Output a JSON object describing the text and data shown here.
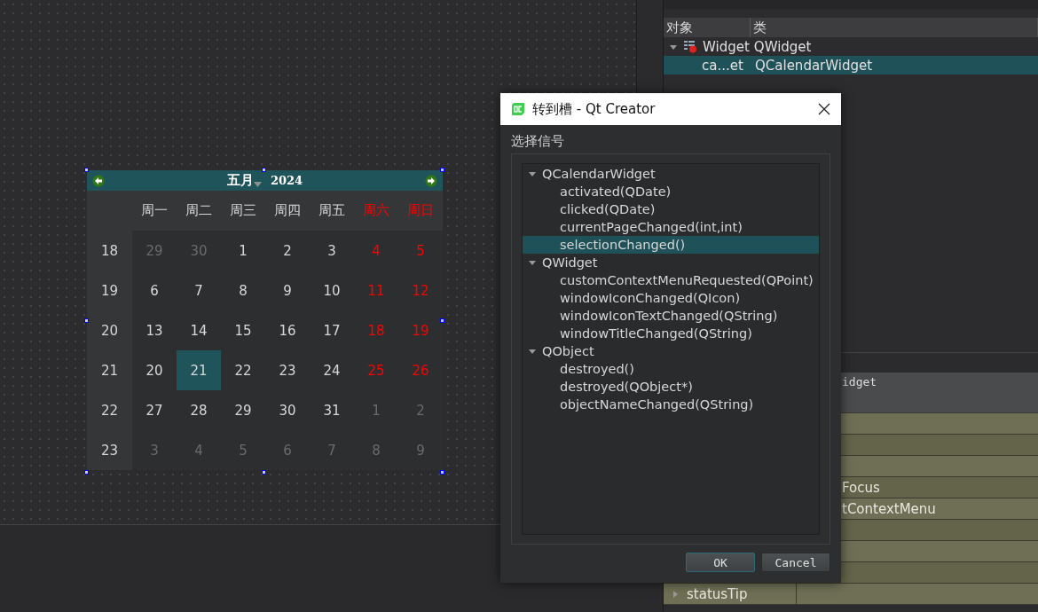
{
  "object_inspector": {
    "columns": [
      "对象",
      "类"
    ],
    "rows": [
      {
        "object": "Widget",
        "class": "QWidget",
        "expanded": true,
        "selected": false,
        "children": [
          {
            "object": "ca...et",
            "class": "QCalendarWidget",
            "selected": true
          }
        ]
      }
    ]
  },
  "property_editor": {
    "header": "idget",
    "rows": [
      {
        "kind": "group"
      },
      {
        "kind": "property"
      },
      {
        "kind": "property"
      },
      {
        "kind": "property"
      },
      {
        "kind": "property",
        "value": "Focus"
      },
      {
        "kind": "property",
        "value": "tContextMenu"
      },
      {
        "kind": "property"
      },
      {
        "kind": "property"
      },
      {
        "kind": "property"
      },
      {
        "kind": "expandable",
        "name": "statusTip"
      }
    ]
  },
  "calendar": {
    "month": "五月",
    "year": "2024",
    "weekdays": [
      {
        "label": "周一",
        "weekend": false
      },
      {
        "label": "周二",
        "weekend": false
      },
      {
        "label": "周三",
        "weekend": false
      },
      {
        "label": "周四",
        "weekend": false
      },
      {
        "label": "周五",
        "weekend": false
      },
      {
        "label": "周六",
        "weekend": true
      },
      {
        "label": "周日",
        "weekend": true
      }
    ],
    "weeks": [
      {
        "number": "18",
        "days": [
          {
            "label": "29",
            "other_month": true,
            "selected": false
          },
          {
            "label": "30",
            "other_month": true,
            "selected": false
          },
          {
            "label": "1",
            "other_month": false,
            "selected": false
          },
          {
            "label": "2",
            "other_month": false,
            "selected": false
          },
          {
            "label": "3",
            "other_month": false,
            "selected": false
          },
          {
            "label": "4",
            "other_month": false,
            "selected": false
          },
          {
            "label": "5",
            "other_month": false,
            "selected": false
          }
        ]
      },
      {
        "number": "19",
        "days": [
          {
            "label": "6",
            "other_month": false,
            "selected": false
          },
          {
            "label": "7",
            "other_month": false,
            "selected": false
          },
          {
            "label": "8",
            "other_month": false,
            "selected": false
          },
          {
            "label": "9",
            "other_month": false,
            "selected": false
          },
          {
            "label": "10",
            "other_month": false,
            "selected": false
          },
          {
            "label": "11",
            "other_month": false,
            "selected": false
          },
          {
            "label": "12",
            "other_month": false,
            "selected": false
          }
        ]
      },
      {
        "number": "20",
        "days": [
          {
            "label": "13",
            "other_month": false,
            "selected": false
          },
          {
            "label": "14",
            "other_month": false,
            "selected": false
          },
          {
            "label": "15",
            "other_month": false,
            "selected": false
          },
          {
            "label": "16",
            "other_month": false,
            "selected": false
          },
          {
            "label": "17",
            "other_month": false,
            "selected": false
          },
          {
            "label": "18",
            "other_month": false,
            "selected": false
          },
          {
            "label": "19",
            "other_month": false,
            "selected": false
          }
        ]
      },
      {
        "number": "21",
        "days": [
          {
            "label": "20",
            "other_month": false,
            "selected": false
          },
          {
            "label": "21",
            "other_month": false,
            "selected": true
          },
          {
            "label": "22",
            "other_month": false,
            "selected": false
          },
          {
            "label": "23",
            "other_month": false,
            "selected": false
          },
          {
            "label": "24",
            "other_month": false,
            "selected": false
          },
          {
            "label": "25",
            "other_month": false,
            "selected": false
          },
          {
            "label": "26",
            "other_month": false,
            "selected": false
          }
        ]
      },
      {
        "number": "22",
        "days": [
          {
            "label": "27",
            "other_month": false,
            "selected": false
          },
          {
            "label": "28",
            "other_month": false,
            "selected": false
          },
          {
            "label": "29",
            "other_month": false,
            "selected": false
          },
          {
            "label": "30",
            "other_month": false,
            "selected": false
          },
          {
            "label": "31",
            "other_month": false,
            "selected": false
          },
          {
            "label": "1",
            "other_month": true,
            "selected": false
          },
          {
            "label": "2",
            "other_month": true,
            "selected": false
          }
        ]
      },
      {
        "number": "23",
        "days": [
          {
            "label": "3",
            "other_month": true,
            "selected": false
          },
          {
            "label": "4",
            "other_month": true,
            "selected": false
          },
          {
            "label": "5",
            "other_month": true,
            "selected": false
          },
          {
            "label": "6",
            "other_month": true,
            "selected": false
          },
          {
            "label": "7",
            "other_month": true,
            "selected": false
          },
          {
            "label": "8",
            "other_month": true,
            "selected": false
          },
          {
            "label": "9",
            "other_month": true,
            "selected": false
          }
        ]
      }
    ]
  },
  "dialog": {
    "title": "转到槽 - Qt Creator",
    "label": "选择信号",
    "signals": [
      {
        "label": "QCalendarWidget",
        "expanded": true,
        "selected": false,
        "children": [
          {
            "label": "activated(QDate)",
            "selected": false
          },
          {
            "label": "clicked(QDate)",
            "selected": false
          },
          {
            "label": "currentPageChanged(int,int)",
            "selected": false
          },
          {
            "label": "selectionChanged()",
            "selected": true
          }
        ]
      },
      {
        "label": "QWidget",
        "expanded": true,
        "selected": false,
        "children": [
          {
            "label": "customContextMenuRequested(QPoint)",
            "selected": false
          },
          {
            "label": "windowIconChanged(QIcon)",
            "selected": false
          },
          {
            "label": "windowIconTextChanged(QString)",
            "selected": false
          },
          {
            "label": "windowTitleChanged(QString)",
            "selected": false
          }
        ]
      },
      {
        "label": "QObject",
        "expanded": true,
        "selected": false,
        "children": [
          {
            "label": "destroyed()",
            "selected": false
          },
          {
            "label": "destroyed(QObject*)",
            "selected": false
          },
          {
            "label": "objectNameChanged(QString)",
            "selected": false
          }
        ]
      }
    ],
    "buttons": [
      {
        "label": "OK",
        "default": true
      },
      {
        "label": "Cancel",
        "default": false
      }
    ]
  }
}
